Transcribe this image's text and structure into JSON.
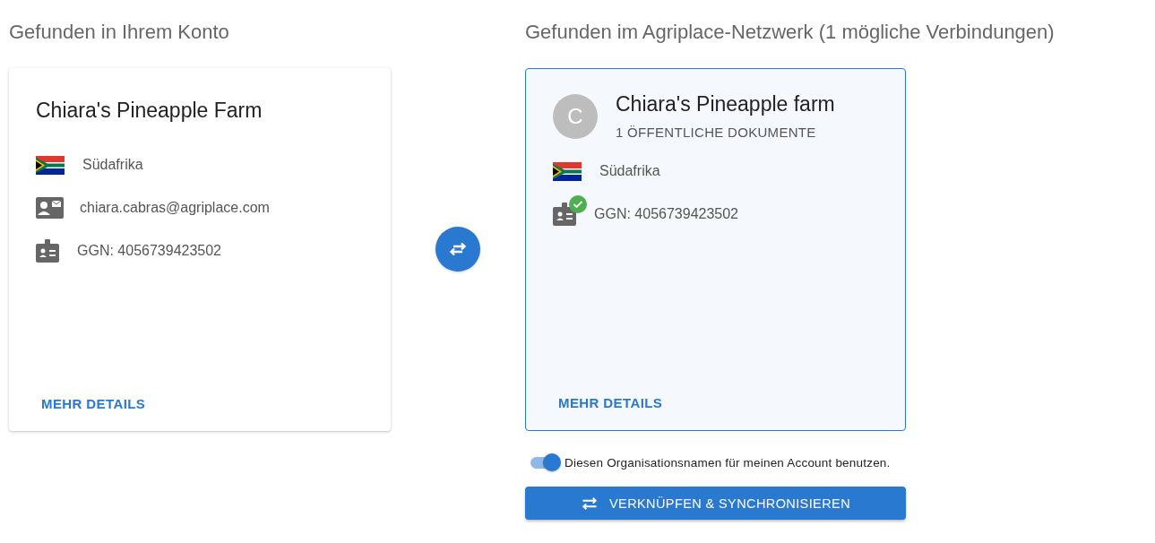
{
  "account": {
    "heading": "Gefunden in Ihrem Konto",
    "card": {
      "name": "Chiara's Pineapple Farm",
      "selected": false,
      "rows": [
        {
          "kind": "country",
          "text": "Südafrika"
        },
        {
          "kind": "email",
          "text": "chiara.cabras@agriplace.com"
        },
        {
          "kind": "ggn",
          "text": "GGN: 4056739423502",
          "verified": false
        }
      ],
      "link": "MEHR DETAILS"
    }
  },
  "network": {
    "heading": "Gefunden im Agriplace-Netzwerk (1 mögliche Verbindungen)",
    "card": {
      "avatar": "C",
      "name": "Chiara's Pineapple farm",
      "subtitle": "1 ÖFFENTLICHE DOKUMENTE",
      "selected": true,
      "rows": [
        {
          "kind": "country",
          "text": "Südafrika"
        },
        {
          "kind": "ggn",
          "text": "GGN: 4056739423502",
          "verified": true
        }
      ],
      "link": "MEHR DETAILS"
    },
    "toggle": {
      "label": "Diesen Organisationsnamen für meinen Account benutzen.",
      "on": true
    },
    "button": "VERKNÜPFEN & SYNCHRONISIEREN"
  }
}
